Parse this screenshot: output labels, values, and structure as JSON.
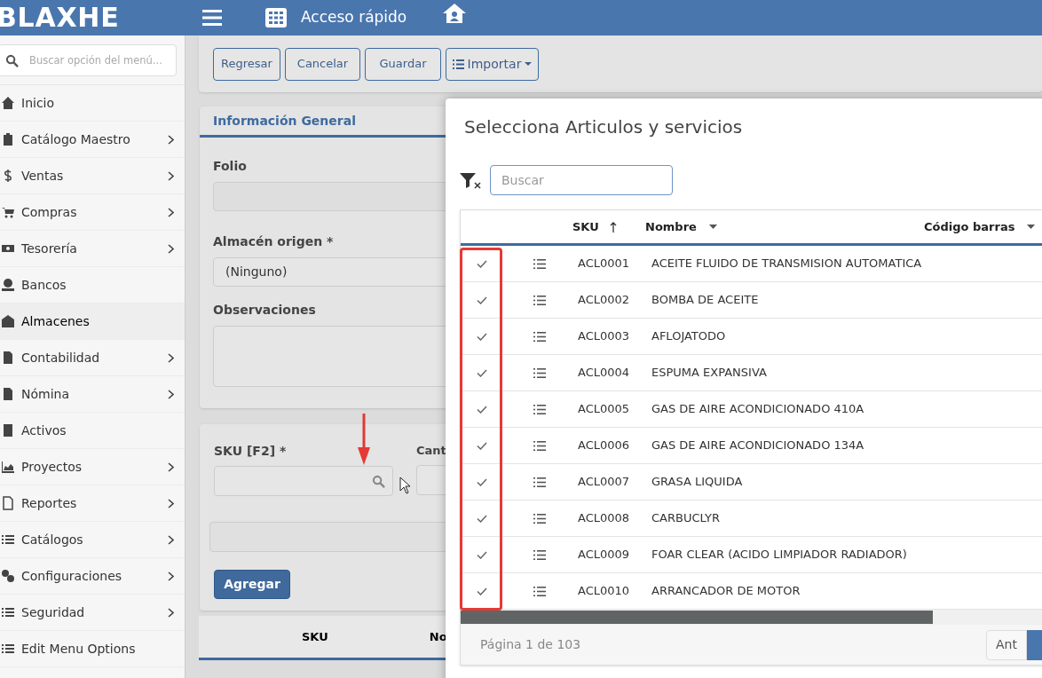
{
  "header": {
    "logo": "BLAXHE",
    "quick_access": "Acceso rápido"
  },
  "sidebar": {
    "search": {
      "placeholder": "Buscar opción del menú..."
    },
    "items": [
      {
        "label": "Inicio",
        "has_submenu": false,
        "selected": false
      },
      {
        "label": "Catálogo Maestro",
        "has_submenu": true,
        "selected": false
      },
      {
        "label": "Ventas",
        "has_submenu": true,
        "selected": false
      },
      {
        "label": "Compras",
        "has_submenu": true,
        "selected": false
      },
      {
        "label": "Tesorería",
        "has_submenu": true,
        "selected": false
      },
      {
        "label": "Bancos",
        "has_submenu": false,
        "selected": false
      },
      {
        "label": "Almacenes",
        "has_submenu": false,
        "selected": true
      },
      {
        "label": "Contabilidad",
        "has_submenu": true,
        "selected": false
      },
      {
        "label": "Nómina",
        "has_submenu": true,
        "selected": false
      },
      {
        "label": "Activos",
        "has_submenu": false,
        "selected": false
      },
      {
        "label": "Proyectos",
        "has_submenu": true,
        "selected": false
      },
      {
        "label": "Reportes",
        "has_submenu": true,
        "selected": false
      },
      {
        "label": "Catálogos",
        "has_submenu": true,
        "selected": false
      },
      {
        "label": "Configuraciones",
        "has_submenu": true,
        "selected": false
      },
      {
        "label": "Seguridad",
        "has_submenu": true,
        "selected": false
      },
      {
        "label": "Edit Menu Options",
        "has_submenu": false,
        "selected": false
      }
    ]
  },
  "toolbar": {
    "buttons": [
      "Regresar",
      "Cancelar",
      "Guardar"
    ],
    "import_button": "Importar"
  },
  "general_info": {
    "title": "Información General",
    "folio_label": "Folio",
    "warehouse_label": "Almacén origen *",
    "warehouse_value": "(Ninguno)",
    "notes_label": "Observaciones"
  },
  "add_item": {
    "sku_label": "SKU [F2] *",
    "quantity_label": "Cant",
    "add_button": "Agregar"
  },
  "items_table": {
    "columns": [
      "SKU",
      "No"
    ]
  },
  "modal": {
    "title": "Selecciona Articulos y servicios",
    "search": {
      "placeholder": "Buscar"
    },
    "columns": [
      "SKU",
      "Nombre",
      "Código barras"
    ],
    "rows": [
      {
        "checked": true,
        "sku": "ACL0001",
        "name": "ACEITE FLUIDO DE TRANSMISION AUTOMATICA"
      },
      {
        "checked": true,
        "sku": "ACL0002",
        "name": "BOMBA DE ACEITE"
      },
      {
        "checked": true,
        "sku": "ACL0003",
        "name": "AFLOJATODO"
      },
      {
        "checked": true,
        "sku": "ACL0004",
        "name": "ESPUMA EXPANSIVA"
      },
      {
        "checked": true,
        "sku": "ACL0005",
        "name": "GAS DE AIRE ACONDICIONADO 410A"
      },
      {
        "checked": true,
        "sku": "ACL0006",
        "name": "GAS DE AIRE ACONDICIONADO 134A"
      },
      {
        "checked": true,
        "sku": "ACL0007",
        "name": "GRASA LIQUIDA"
      },
      {
        "checked": true,
        "sku": "ACL0008",
        "name": "CARBUCLYR"
      },
      {
        "checked": true,
        "sku": "ACL0009",
        "name": "FOAR CLEAR (ACIDO LIMPIADOR RADIADOR)"
      },
      {
        "checked": true,
        "sku": "ACL0010",
        "name": "ARRANCADOR DE MOTOR"
      }
    ],
    "page_info": "Página 1 de 103",
    "prev_button": "Ant"
  }
}
